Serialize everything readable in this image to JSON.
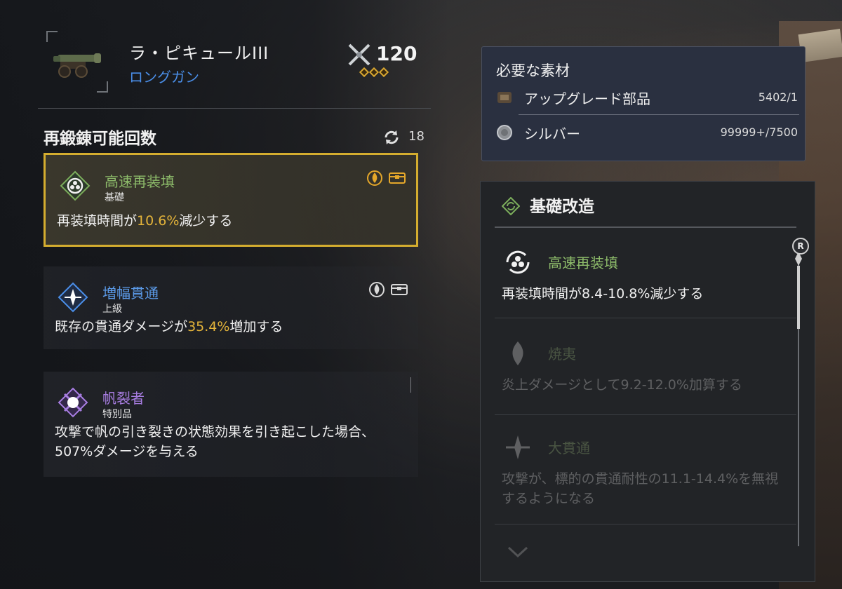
{
  "weapon": {
    "name": "ラ・ピキュールIII",
    "type": "ロングガン",
    "power": "120",
    "rank_stars": 3
  },
  "reforge": {
    "title": "再鍛錬可能回数",
    "count": "18"
  },
  "perks": [
    {
      "name": "高速再装填",
      "tier": "基礎",
      "desc_pre": "再装填時間が",
      "desc_value": "10.6%",
      "desc_post": "減少する",
      "name_color": "#8dbb6a",
      "selected": true
    },
    {
      "name": "増幅貫通",
      "tier": "上級",
      "desc_pre": "既存の貫通ダメージが",
      "desc_value": "35.4%",
      "desc_post": "増加する",
      "name_color": "#5b9ae8",
      "selected": false
    },
    {
      "name": "帆裂者",
      "tier": "特別品",
      "desc": "攻撃で帆の引き裂きの状態効果を引き起こした場合、507%ダメージを与える",
      "name_color": "#a77de0",
      "selected": false
    }
  ],
  "materials": {
    "title": "必要な素材",
    "items": [
      {
        "name": "アップグレード部品",
        "qty": "5402/1"
      },
      {
        "name": "シルバー",
        "qty": "99999+/7500"
      }
    ]
  },
  "mods": {
    "title": "基礎改造",
    "scroll_badge": "R",
    "items": [
      {
        "name": "高速再装填",
        "desc": "再装填時間が8.4-10.8%減少する",
        "active": true
      },
      {
        "name": "焼夷",
        "desc": "炎上ダメージとして9.2-12.0%加算する",
        "active": false
      },
      {
        "name": "大貫通",
        "desc": "攻撃が、標的の貫通耐性の11.1-14.4%を無視するようになる",
        "active": false
      }
    ]
  },
  "colors": {
    "accent_gold": "#d4ad2f",
    "value_highlight": "#e4b43a",
    "blue_type": "#4a8ee8",
    "green_perk": "#8dbb6a"
  }
}
